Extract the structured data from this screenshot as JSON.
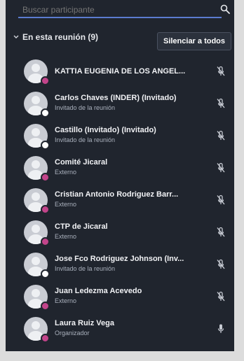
{
  "search": {
    "placeholder": "Buscar participante"
  },
  "section": {
    "title": "En esta reunión (9)",
    "mute_all_label": "Silenciar a todos"
  },
  "colors": {
    "status_external": "#c2448a",
    "status_invited": "#ffffff",
    "accent": "#5b7bd0"
  },
  "participants": [
    {
      "name": "KATTIA EUGENIA DE LOS ANGEL...",
      "role": "",
      "status": "external",
      "mic": "muted"
    },
    {
      "name": "Carlos Chaves (INDER) (Invitado)",
      "role": "Invitado de la reunión",
      "status": "invited",
      "mic": "muted"
    },
    {
      "name": "Castillo (Invitado) (Invitado)",
      "role": "Invitado de la reunión",
      "status": "invited",
      "mic": "muted"
    },
    {
      "name": "Comité Jicaral",
      "role": "Externo",
      "status": "external",
      "mic": "muted"
    },
    {
      "name": "Cristian Antonio Rodriguez Barr...",
      "role": "Externo",
      "status": "external",
      "mic": "muted"
    },
    {
      "name": "CTP de Jicaral",
      "role": "Externo",
      "status": "external",
      "mic": "muted"
    },
    {
      "name": "Jose Fco Rodriguez Johnson (Inv...",
      "role": "Invitado de la reunión",
      "status": "invited",
      "mic": "muted"
    },
    {
      "name": "Juan Ledezma Acevedo",
      "role": "Externo",
      "status": "external",
      "mic": "muted"
    },
    {
      "name": "Laura Ruiz Vega",
      "role": "Organizador",
      "status": "external",
      "mic": "on"
    }
  ]
}
